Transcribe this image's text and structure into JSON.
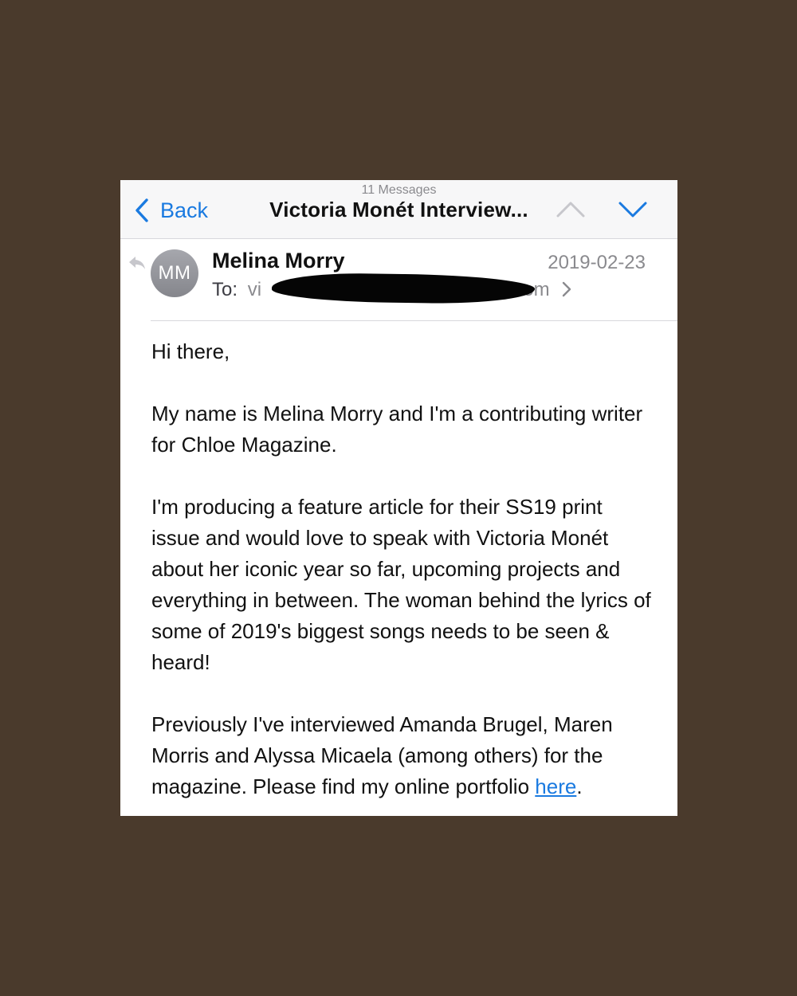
{
  "nav": {
    "back_label": "Back",
    "message_count": "11 Messages",
    "subject": "Victoria Monét Interview..."
  },
  "header": {
    "avatar_initials": "MM",
    "sender": "Melina Morry",
    "date": "2019-02-23",
    "to_label": "To:",
    "to_address_visible": "vi",
    "to_address_tail": "il.com"
  },
  "body": {
    "greeting": "Hi there,",
    "p1": "My name is Melina Morry and I'm a contributing writer for Chloe Magazine.",
    "p2": "I'm producing a feature article for their SS19 print issue and would love to speak with Victoria Monét about her iconic year so far, upcoming projects and everything in between. The woman behind the lyrics of some of 2019's biggest songs needs to be seen & heard!",
    "p3_text": "Previously I've interviewed Amanda Brugel, Maren Morris and Alyssa Micaela (among others) for the magazine. Please find my online portfolio ",
    "p3_link": "here",
    "p3_end": "."
  },
  "colors": {
    "background": "#4a3a2c",
    "accent": "#1a7ae0",
    "secondary_text": "#8a8a8e"
  },
  "icons": {
    "back": "chevron-left-icon",
    "previous": "chevron-up-icon",
    "next": "chevron-down-icon",
    "reply": "reply-arrow-icon",
    "recipient_details": "chevron-right-icon"
  }
}
